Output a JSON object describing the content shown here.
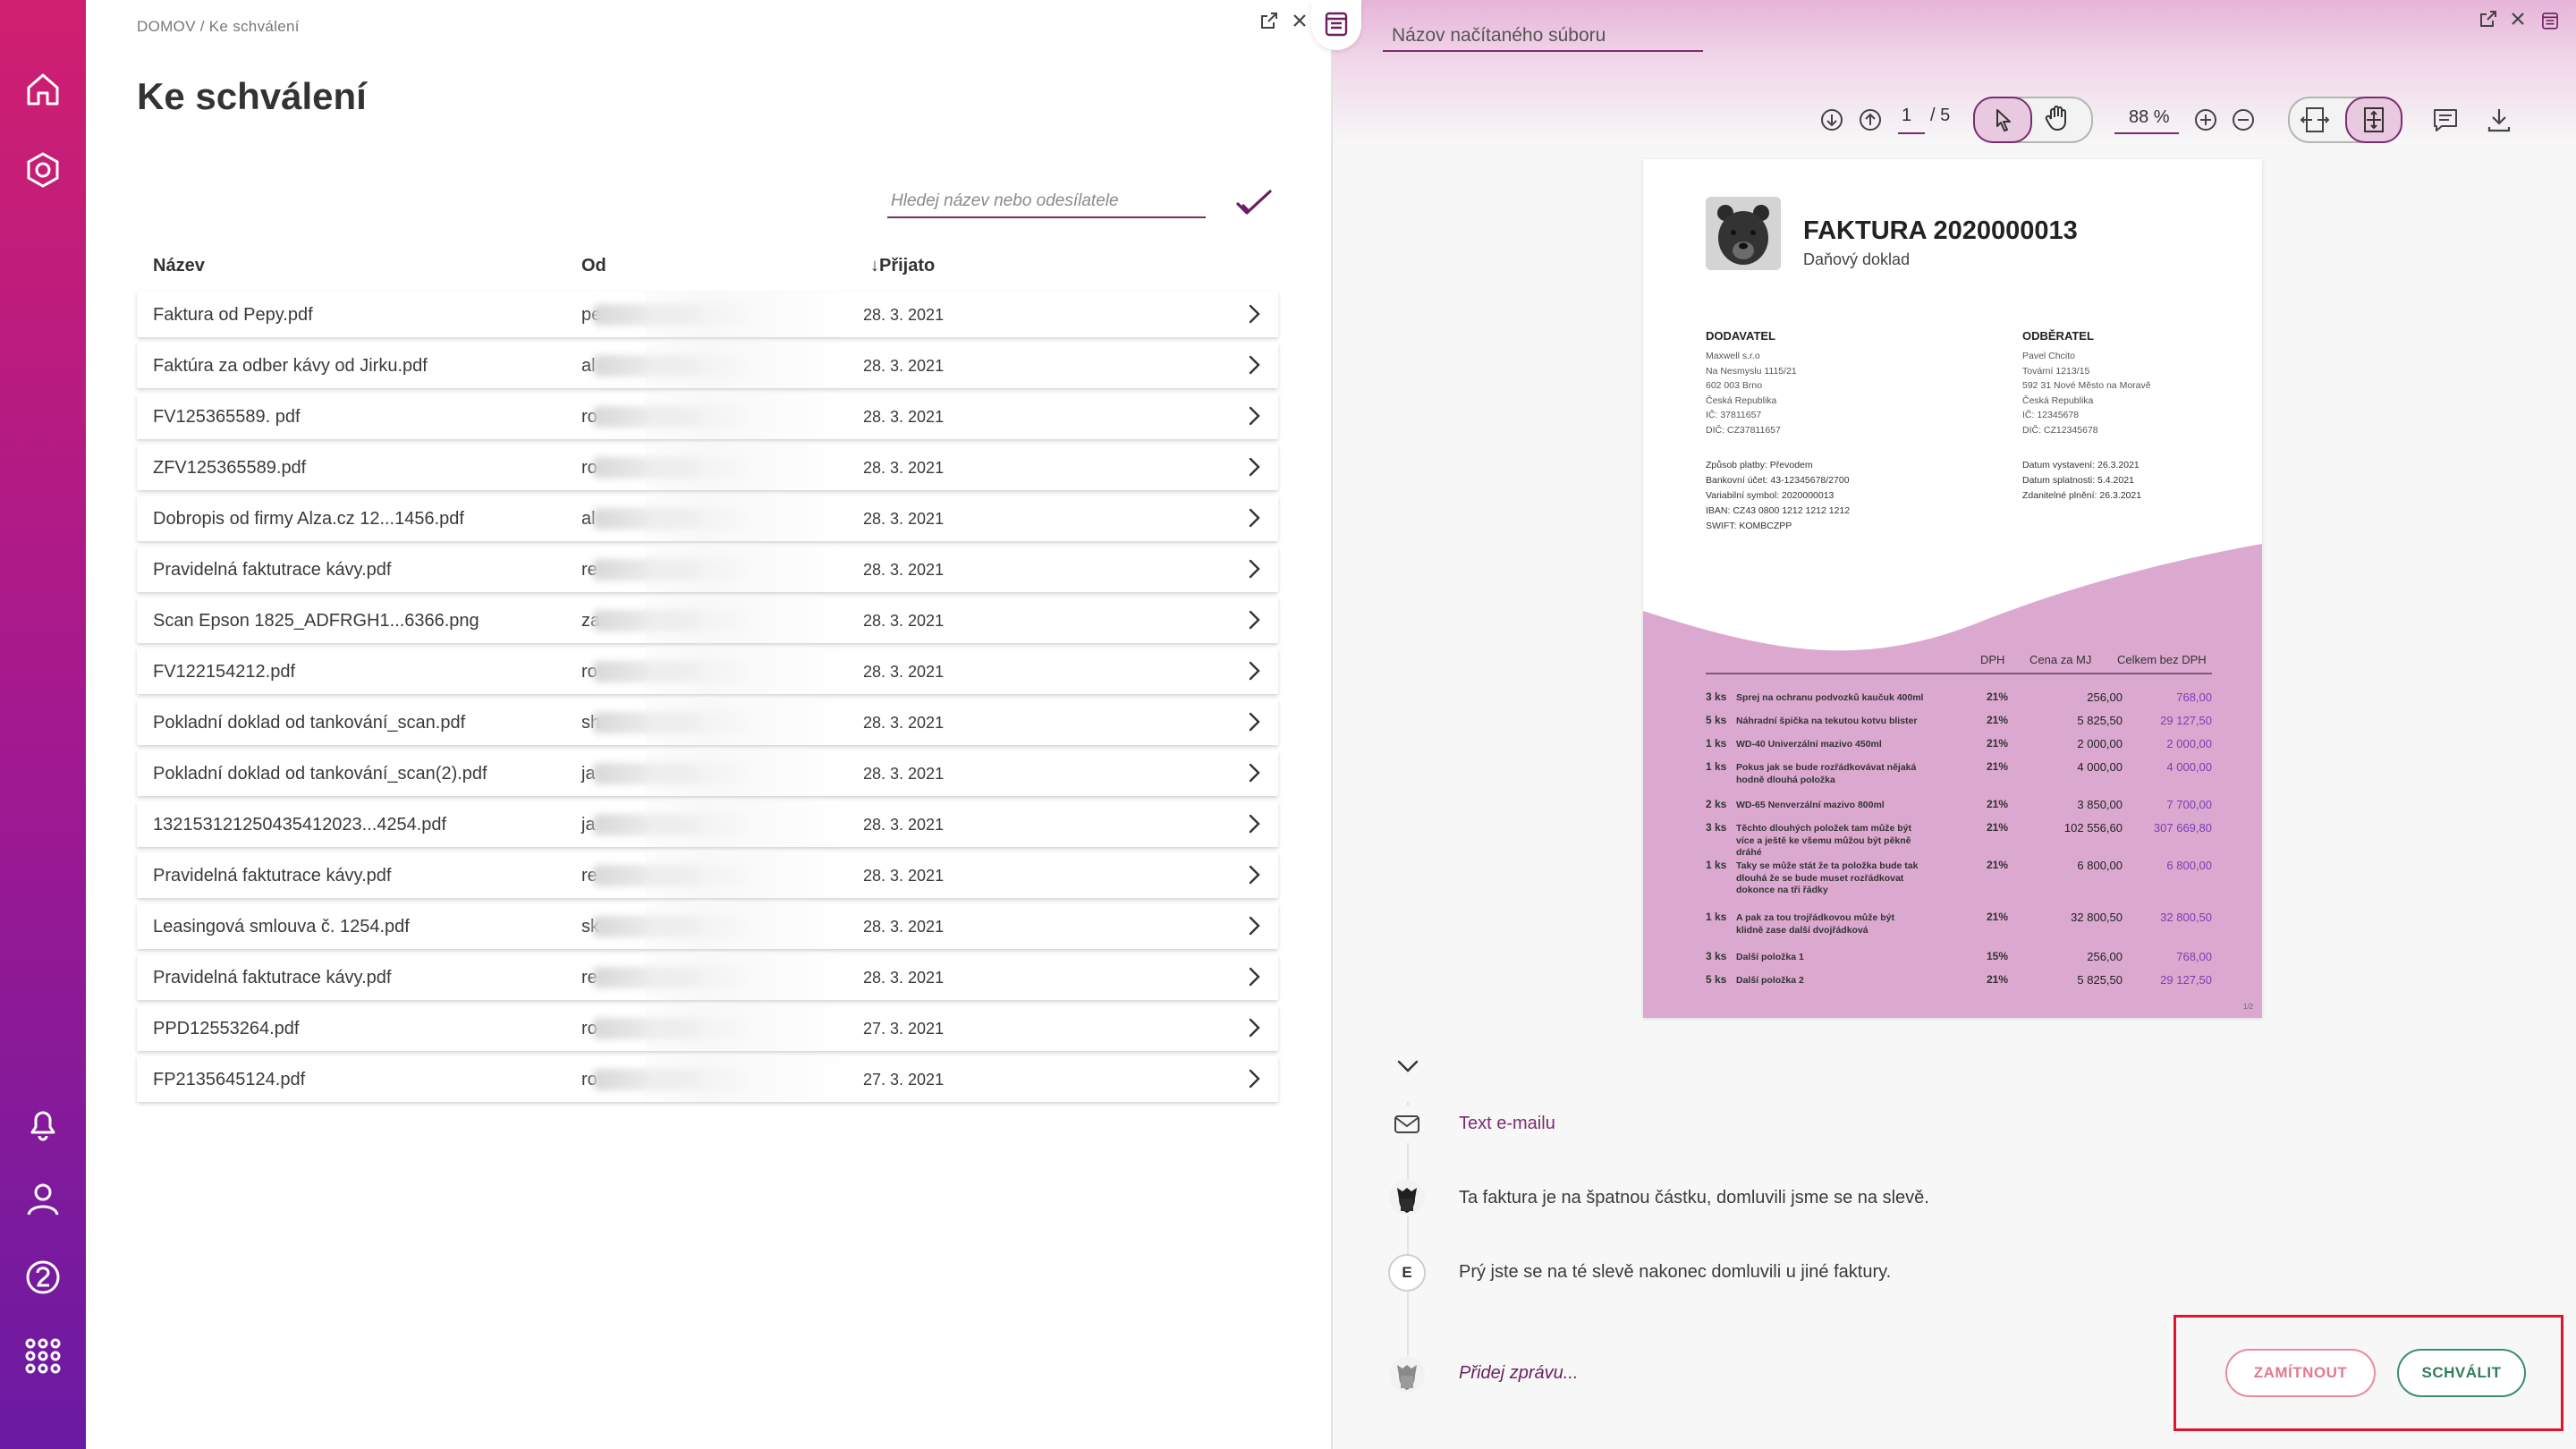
{
  "breadcrumb": "DOMOV / Ke schválení",
  "page_title": "Ke schválení",
  "search": {
    "placeholder": "Hledej název nebo odesílatele"
  },
  "table": {
    "headers": {
      "name": "Název",
      "from": "Od",
      "received": "Přijato",
      "sort_arrow": "↓"
    },
    "rows": [
      {
        "name": "Faktura od Pepy.pdf",
        "from": "pe",
        "date": "28. 3. 2021"
      },
      {
        "name": "Faktúra za odber kávy od Jirku.pdf",
        "from": "al",
        "date": "28. 3. 2021"
      },
      {
        "name": "FV125365589. pdf",
        "from": "ro",
        "date": "28. 3. 2021"
      },
      {
        "name": "ZFV125365589.pdf",
        "from": "ro",
        "date": "28. 3. 2021"
      },
      {
        "name": "Dobropis od firmy Alza.cz 12...1456.pdf",
        "from": "al",
        "date": "28. 3. 2021"
      },
      {
        "name": "Pravidelná faktutrace kávy.pdf",
        "from": "re",
        "date": "28. 3. 2021"
      },
      {
        "name": "Scan Epson 1825_ADFRGH1...6366.png",
        "from": "za",
        "date": "28. 3. 2021"
      },
      {
        "name": "FV122154212.pdf",
        "from": "ro",
        "date": "28. 3. 2021"
      },
      {
        "name": "Pokladní doklad od tankování_scan.pdf",
        "from": "sh",
        "date": "28. 3. 2021"
      },
      {
        "name": "Pokladní doklad od tankování_scan(2).pdf",
        "from": "ja",
        "date": "28. 3. 2021"
      },
      {
        "name": "132153121250435412023...4254.pdf",
        "from": "ja",
        "date": "28. 3. 2021"
      },
      {
        "name": "Pravidelná faktutrace kávy.pdf",
        "from": "re",
        "date": "28. 3. 2021"
      },
      {
        "name": "Leasingová smlouva č. 1254.pdf",
        "from": "sk",
        "date": "28. 3. 2021"
      },
      {
        "name": "Pravidelná faktutrace kávy.pdf",
        "from": "re",
        "date": "28. 3. 2021"
      },
      {
        "name": "PPD12553264.pdf",
        "from": "ro",
        "date": "27. 3. 2021"
      },
      {
        "name": "FP2135645124.pdf",
        "from": "ro",
        "date": "27. 3. 2021"
      }
    ]
  },
  "viewer": {
    "file_title": "Názov načítaného súboru",
    "page_current": "1",
    "page_total": "/ 5",
    "zoom": "88 %"
  },
  "invoice": {
    "title": "FAKTURA 2020000013",
    "subtitle": "Daňový doklad",
    "supplier": {
      "heading": "DODAVATEL",
      "lines": [
        "Maxwell s.r.o",
        "Na Nesmyslu 1115/21",
        "602 003 Brno",
        "Česká Republika",
        "IČ: 37811657",
        "DIČ: CZ37811657"
      ]
    },
    "customer": {
      "heading": "ODBĚRATEL",
      "lines": [
        "Pavel Chcito",
        "Tovární 1213/15",
        "592 31 Nové Město na Moravě",
        "Česká Republika",
        "IČ: 12345678",
        "DIČ: CZ12345678"
      ]
    },
    "payment_lines": [
      "Způsob platby: Převodem",
      "Bankovní účet: 43-12345678/2700",
      "Variabilní symbol: 2020000013",
      "IBAN: CZ43 0800 1212 1212 1212",
      "SWIFT: KOMBCZPP"
    ],
    "date_lines": [
      "Datum vystavení: 26.3.2021",
      "Datum splatnosti: 5.4.2021",
      "Zdanitelné plnění: 26.3.2021"
    ],
    "item_headers": {
      "vat": "DPH",
      "unit_price": "Cena za MJ",
      "total": "Celkem bez DPH"
    },
    "items": [
      {
        "qty": "3 ks",
        "desc": "Sprej na ochranu podvozků kaučuk 400ml",
        "vat": "21%",
        "price": "256,00",
        "total": "768,00"
      },
      {
        "qty": "5 ks",
        "desc": "Náhradní špička na tekutou kotvu blister",
        "vat": "21%",
        "price": "5 825,50",
        "total": "29 127,50"
      },
      {
        "qty": "1 ks",
        "desc": "WD-40 Univerzální mazivo 450ml",
        "vat": "21%",
        "price": "2 000,00",
        "total": "2 000,00"
      },
      {
        "qty": "1 ks",
        "desc": "Pokus jak se bude rozřádkovávat nějaká hodně dlouhá položka",
        "vat": "21%",
        "price": "4 000,00",
        "total": "4 000,00"
      },
      {
        "qty": "2 ks",
        "desc": "WD-65 Nenverzální mazivo 800ml",
        "vat": "21%",
        "price": "3 850,00",
        "total": "7 700,00"
      },
      {
        "qty": "3 ks",
        "desc": "Těchto dlouhých položek tam může být více a ještě ke všemu můžou být pěkně dráhé",
        "vat": "21%",
        "price": "102 556,60",
        "total": "307 669,80"
      },
      {
        "qty": "1 ks",
        "desc": "Taky se může stát že ta položka bude tak dlouhá že se bude muset rozřádkovat dokonce na tři řádky",
        "vat": "21%",
        "price": "6 800,00",
        "total": "6 800,00"
      },
      {
        "qty": "1 ks",
        "desc": "A pak za tou trojřádkovou může být klidně zase další dvojřádková",
        "vat": "21%",
        "price": "32 800,50",
        "total": "32 800,50"
      },
      {
        "qty": "3 ks",
        "desc": "Další položka 1",
        "vat": "15%",
        "price": "256,00",
        "total": "768,00"
      },
      {
        "qty": "5 ks",
        "desc": "Další položka 2",
        "vat": "21%",
        "price": "5 825,50",
        "total": "29 127,50"
      }
    ],
    "page_no": "1/2"
  },
  "thread": {
    "email_link": "Text e-mailu",
    "messages": [
      "Ta faktura je na špatnou částku, domluvili jsme se na slevě.",
      "Prý jste se na té slevě nakonec domluvili u jiné faktury."
    ],
    "e_initial": "E",
    "add_message": "Přidej zprávu..."
  },
  "actions": {
    "reject": "ZAMÍTNOUT",
    "approve": "SCHVÁLIT"
  },
  "colors": {
    "accent": "#7a2c6e",
    "rail_top": "#d01f6f",
    "rail_bottom": "#6a1aa3",
    "approve": "#2f7d5a",
    "reject": "#e07a8e",
    "highlight": "#e0142a"
  }
}
